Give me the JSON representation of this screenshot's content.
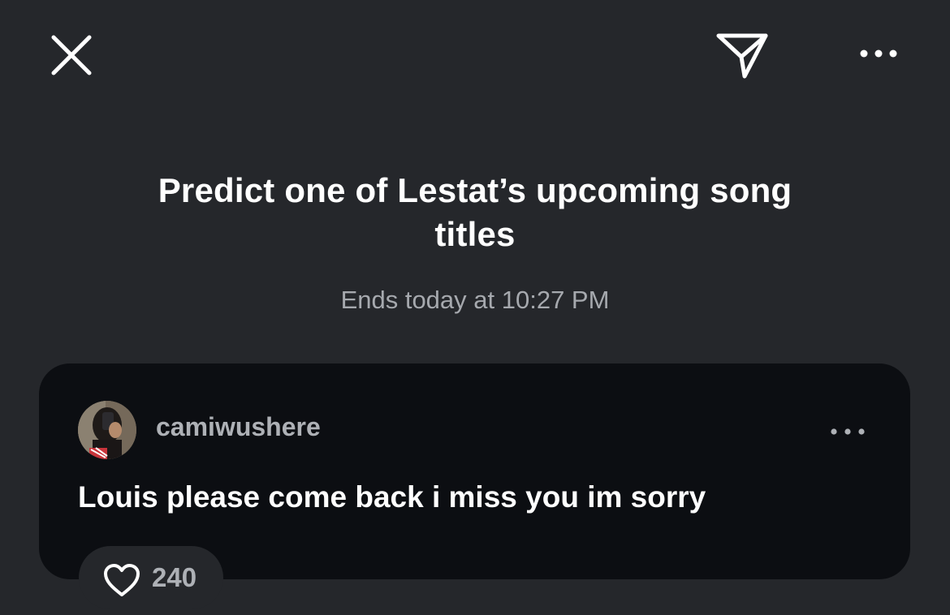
{
  "header": {
    "close_icon": "close-icon",
    "send_icon": "send-icon",
    "more_icon": "more-horizontal-icon"
  },
  "prompt": {
    "title": "Predict one of Lestat’s upcoming song titles",
    "ends_text": "Ends today at 10:27 PM"
  },
  "reply": {
    "username": "camiwushere",
    "avatar_icon": "avatar",
    "message": "Louis please come back i miss you im sorry",
    "more_icon": "more-horizontal-icon",
    "like_icon": "heart-icon",
    "like_count": "240"
  }
}
